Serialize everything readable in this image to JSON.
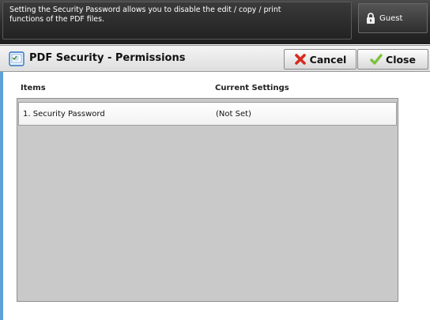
{
  "message_bar": {
    "line1": "Setting the Security Password allows you to disable the edit / copy / print",
    "line2": "functions of the PDF files."
  },
  "user": {
    "label": "Guest",
    "icon": "lock-icon"
  },
  "title_bar": {
    "title": "PDF Security - Permissions",
    "icon": "pdf-security-icon",
    "cancel_label": "Cancel",
    "close_label": "Close"
  },
  "table": {
    "headers": {
      "items": "Items",
      "current_settings": "Current Settings"
    },
    "rows": [
      {
        "item": "1. Security Password",
        "setting": "(Not Set)"
      }
    ]
  },
  "colors": {
    "accent": "#5fa0d8",
    "cancel_icon": "#d62a1e",
    "close_icon": "#7cc23a"
  }
}
